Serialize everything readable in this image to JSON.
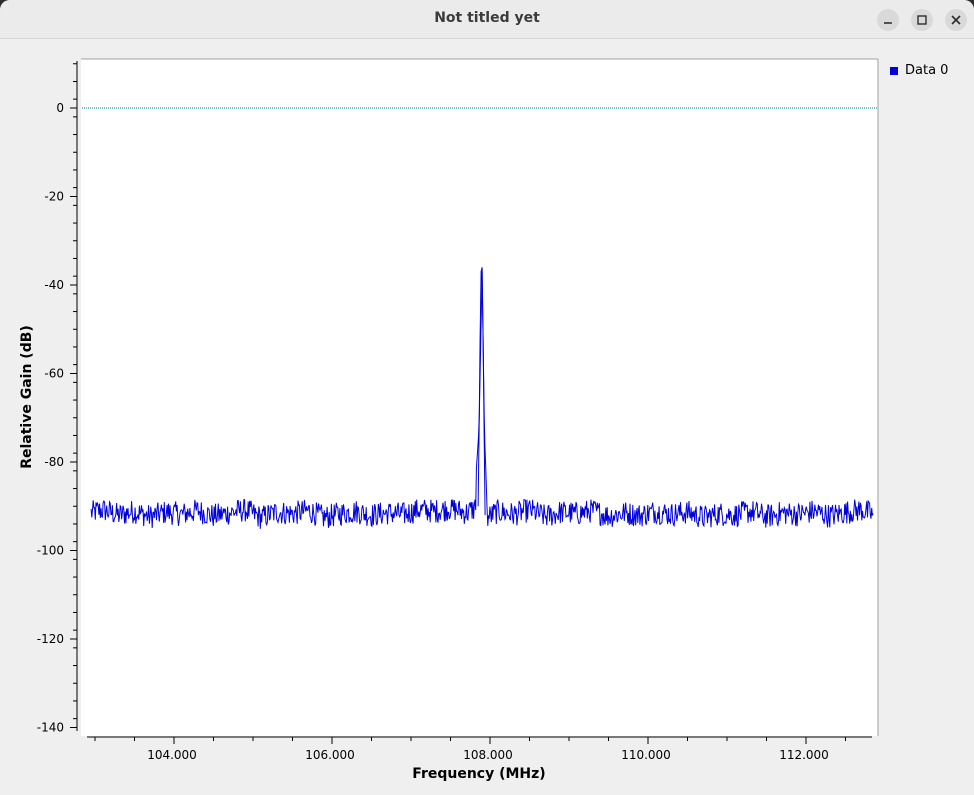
{
  "window": {
    "title": "Not titled yet"
  },
  "legend": {
    "items": [
      {
        "label": "Data 0",
        "color": "#0000dd"
      }
    ]
  },
  "chart_data": {
    "type": "line",
    "xlabel": "Frequency (MHz)",
    "ylabel": "Relative Gain (dB)",
    "xlim": [
      102.85,
      112.9
    ],
    "ylim": [
      -140,
      11
    ],
    "x_ticks": [
      104.0,
      106.0,
      108.0,
      110.0,
      112.0
    ],
    "x_tick_labels": [
      "104.000",
      "106.000",
      "108.000",
      "110.000",
      "112.000"
    ],
    "y_ticks": [
      0,
      -20,
      -40,
      -60,
      -80,
      -100,
      -120,
      -140
    ],
    "y_tick_labels": [
      "0",
      "-20",
      "-40",
      "-60",
      "-80",
      "-100",
      "-120",
      "-140"
    ],
    "grid": false,
    "legend_position": "right",
    "reference_line": {
      "y": 0,
      "color": "#008080",
      "style": "dotted"
    },
    "series": [
      {
        "name": "Data 0",
        "color": "#0000dd",
        "noise_floor_db": -91.5,
        "noise_range_db": [
          -96.5,
          -88.5
        ],
        "peak": {
          "x": 107.9,
          "y": -37
        },
        "x_range": [
          102.95,
          112.85
        ],
        "points": [
          [
            102.95,
            -91.5
          ],
          [
            103.1,
            -89.5
          ],
          [
            103.3,
            -93.0
          ],
          [
            103.5,
            -90.5
          ],
          [
            103.7,
            -94.0
          ],
          [
            103.9,
            -91.0
          ],
          [
            104.1,
            -92.5
          ],
          [
            104.3,
            -90.0
          ],
          [
            104.5,
            -93.5
          ],
          [
            104.7,
            -91.5
          ],
          [
            104.9,
            -89.5
          ],
          [
            105.1,
            -94.5
          ],
          [
            105.3,
            -91.0
          ],
          [
            105.5,
            -92.0
          ],
          [
            105.7,
            -90.0
          ],
          [
            105.9,
            -94.5
          ],
          [
            106.1,
            -92.0
          ],
          [
            106.3,
            -90.5
          ],
          [
            106.5,
            -93.0
          ],
          [
            106.7,
            -91.5
          ],
          [
            106.9,
            -92.5
          ],
          [
            107.1,
            -89.5
          ],
          [
            107.3,
            -90.5
          ],
          [
            107.5,
            -88.5
          ],
          [
            107.7,
            -91.5
          ],
          [
            107.8,
            -89.0
          ],
          [
            107.86,
            -73.0
          ],
          [
            107.9,
            -37.0
          ],
          [
            107.93,
            -73.0
          ],
          [
            107.97,
            -94.5
          ],
          [
            108.1,
            -90.5
          ],
          [
            108.3,
            -92.5
          ],
          [
            108.5,
            -89.5
          ],
          [
            108.7,
            -94.0
          ],
          [
            108.9,
            -91.0
          ],
          [
            109.1,
            -92.0
          ],
          [
            109.3,
            -90.0
          ],
          [
            109.5,
            -93.5
          ],
          [
            109.7,
            -91.5
          ],
          [
            109.9,
            -93.0
          ],
          [
            110.1,
            -90.5
          ],
          [
            110.3,
            -92.5
          ],
          [
            110.5,
            -91.0
          ],
          [
            110.7,
            -94.5
          ],
          [
            110.9,
            -92.0
          ],
          [
            111.1,
            -93.0
          ],
          [
            111.3,
            -90.5
          ],
          [
            111.5,
            -94.0
          ],
          [
            111.7,
            -91.5
          ],
          [
            111.9,
            -92.5
          ],
          [
            112.1,
            -90.5
          ],
          [
            112.3,
            -93.5
          ],
          [
            112.5,
            -91.0
          ],
          [
            112.7,
            -89.5
          ],
          [
            112.85,
            -92.5
          ]
        ]
      }
    ]
  }
}
